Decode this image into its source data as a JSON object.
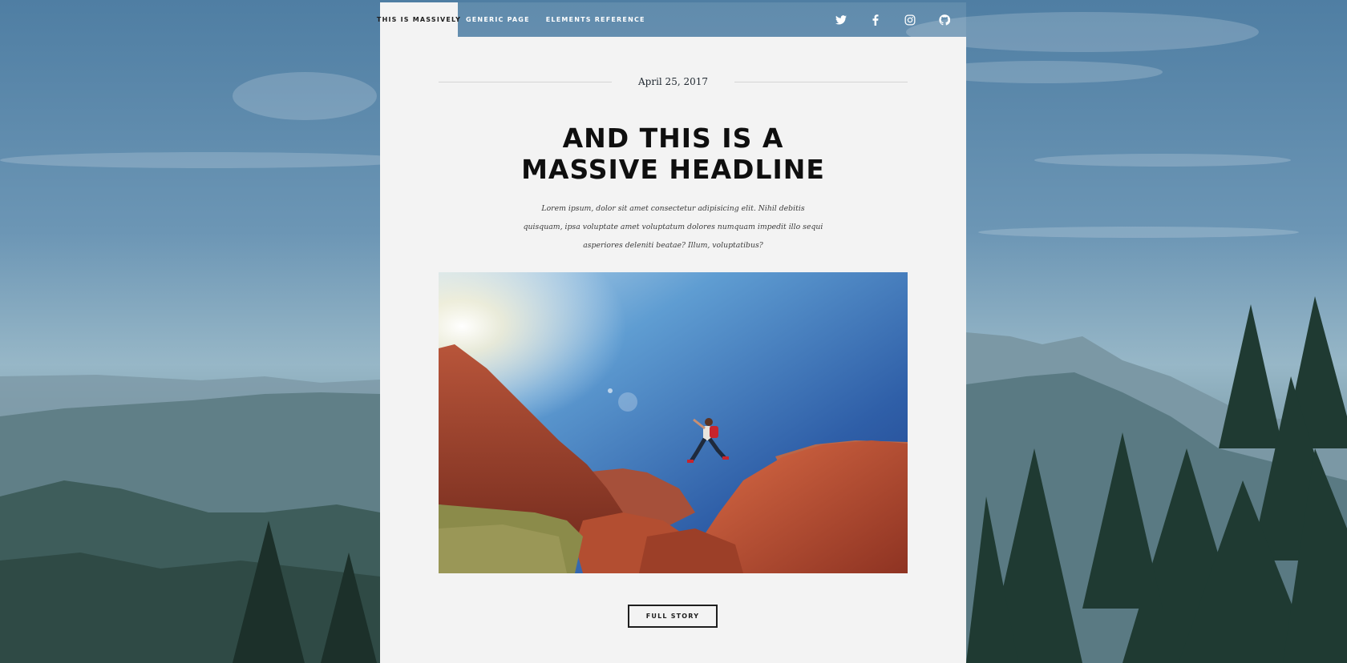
{
  "nav": {
    "links": [
      {
        "label": "THIS IS MASSIVELY"
      },
      {
        "label": "GENERIC PAGE"
      },
      {
        "label": "ELEMENTS REFERENCE"
      }
    ],
    "social_icons": [
      "twitter-icon",
      "facebook-icon",
      "instagram-icon",
      "github-icon"
    ]
  },
  "post": {
    "date": "April 25, 2017",
    "headline_line1": "AND THIS IS A",
    "headline_line2": "MASSIVE HEADLINE",
    "excerpt": "Lorem ipsum, dolor sit amet consectetur adipisicing elit. Nihil debitis quisquam, ipsa voluptate amet voluptatum dolores numquam impedit illo sequi asperiores deleniti beatae? Illum, voluptatibus?",
    "button_label": "FULL STORY"
  },
  "colors": {
    "panel": "#f3f3f3",
    "text": "#212931",
    "headline": "#0f0f0f",
    "sky": "#5b86a8"
  }
}
